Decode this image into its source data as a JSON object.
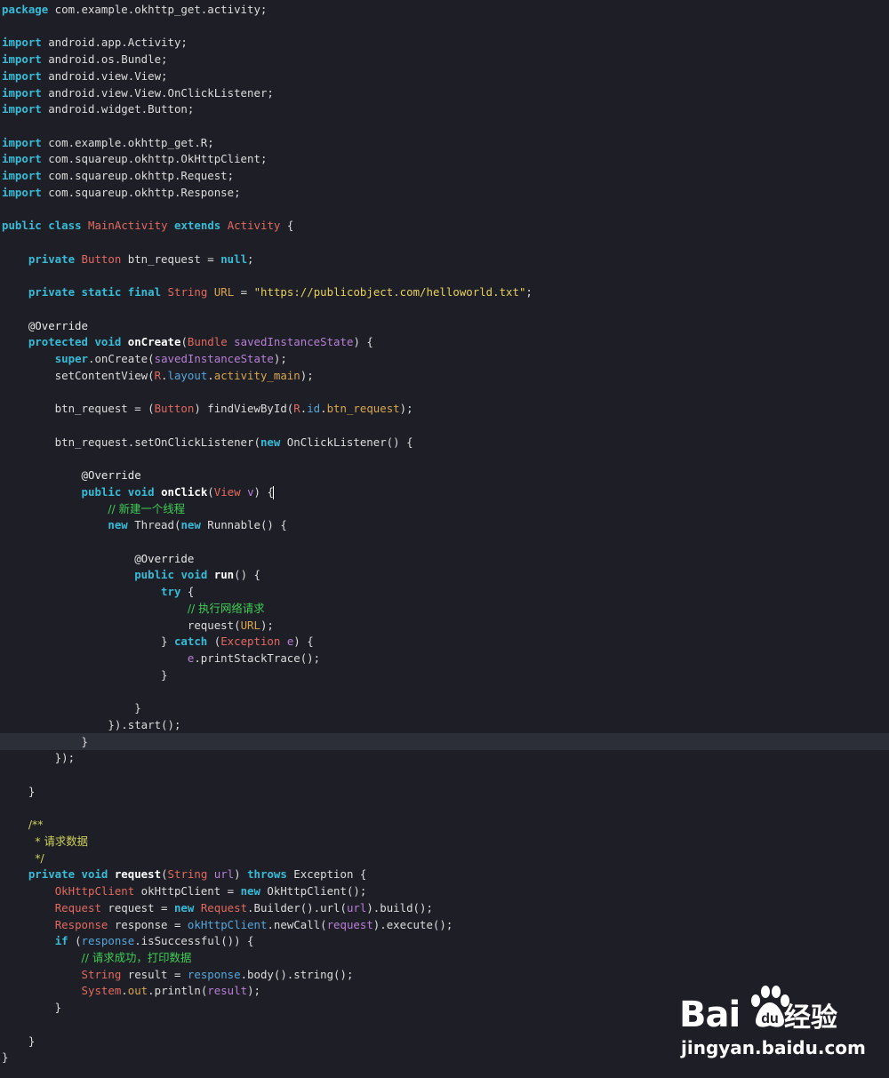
{
  "editor": {
    "language": "java",
    "cursor_line": 44,
    "colors": {
      "background": "#1e1f26",
      "current_line": "#2c2e38",
      "keyword": "#37bbd6",
      "type": "#e2695f",
      "string": "#e6cf5c",
      "comment": "#3fcd55",
      "field": "#55a6dc",
      "parameter": "#b87fd6"
    },
    "lines": [
      [
        [
          "kw",
          "package"
        ],
        [
          "tx",
          " com.example.okhttp_get.activity;"
        ]
      ],
      [],
      [
        [
          "kw",
          "import"
        ],
        [
          "tx",
          " android.app.Activity;"
        ]
      ],
      [
        [
          "kw",
          "import"
        ],
        [
          "tx",
          " android.os.Bundle;"
        ]
      ],
      [
        [
          "kw",
          "import"
        ],
        [
          "tx",
          " android.view.View;"
        ]
      ],
      [
        [
          "kw",
          "import"
        ],
        [
          "tx",
          " android.view.View.OnClickListener;"
        ]
      ],
      [
        [
          "kw",
          "import"
        ],
        [
          "tx",
          " android.widget.Button;"
        ]
      ],
      [],
      [
        [
          "kw",
          "import"
        ],
        [
          "tx",
          " com.example.okhttp_get.R;"
        ]
      ],
      [
        [
          "kw",
          "import"
        ],
        [
          "tx",
          " com.squareup.okhttp.OkHttpClient;"
        ]
      ],
      [
        [
          "kw",
          "import"
        ],
        [
          "tx",
          " com.squareup.okhttp.Request;"
        ]
      ],
      [
        [
          "kw",
          "import"
        ],
        [
          "tx",
          " com.squareup.okhttp.Response;"
        ]
      ],
      [],
      [
        [
          "kw",
          "public"
        ],
        [
          "tx",
          " "
        ],
        [
          "kw",
          "class"
        ],
        [
          "tx",
          " "
        ],
        [
          "ty",
          "MainActivity"
        ],
        [
          "tx",
          " "
        ],
        [
          "kw",
          "extends"
        ],
        [
          "tx",
          " "
        ],
        [
          "ty",
          "Activity"
        ],
        [
          "tx",
          " {"
        ]
      ],
      [],
      [
        [
          "tx",
          "    "
        ],
        [
          "kw",
          "private"
        ],
        [
          "tx",
          " "
        ],
        [
          "ty",
          "Button"
        ],
        [
          "tx",
          " btn_request = "
        ],
        [
          "kw",
          "null"
        ],
        [
          "tx",
          ";"
        ]
      ],
      [],
      [
        [
          "tx",
          "    "
        ],
        [
          "kw",
          "private"
        ],
        [
          "tx",
          " "
        ],
        [
          "kw",
          "static"
        ],
        [
          "tx",
          " "
        ],
        [
          "kw",
          "final"
        ],
        [
          "tx",
          " "
        ],
        [
          "ty",
          "String"
        ],
        [
          "tx",
          " "
        ],
        [
          "fi",
          "URL"
        ],
        [
          "tx",
          " = "
        ],
        [
          "st",
          "\"https://publicobject.com/helloworld.txt\""
        ],
        [
          "tx",
          ";"
        ]
      ],
      [],
      [
        [
          "tx",
          "    "
        ],
        [
          "an",
          "@Override"
        ]
      ],
      [
        [
          "tx",
          "    "
        ],
        [
          "kw",
          "protected"
        ],
        [
          "tx",
          " "
        ],
        [
          "kw",
          "void"
        ],
        [
          "tx",
          " "
        ],
        [
          "mt",
          "onCreate"
        ],
        [
          "tx",
          "("
        ],
        [
          "ty",
          "Bundle"
        ],
        [
          "tx",
          " "
        ],
        [
          "pa",
          "savedInstanceState"
        ],
        [
          "tx",
          ") {"
        ]
      ],
      [
        [
          "tx",
          "        "
        ],
        [
          "kw",
          "super"
        ],
        [
          "tx",
          ".onCreate("
        ],
        [
          "pa",
          "savedInstanceState"
        ],
        [
          "tx",
          ");"
        ]
      ],
      [
        [
          "tx",
          "        setContentView("
        ],
        [
          "ty",
          "R"
        ],
        [
          "tx",
          "."
        ],
        [
          "fd",
          "layout"
        ],
        [
          "tx",
          "."
        ],
        [
          "fi",
          "activity_main"
        ],
        [
          "tx",
          ");"
        ]
      ],
      [],
      [
        [
          "tx",
          "        btn_request = ("
        ],
        [
          "ty",
          "Button"
        ],
        [
          "tx",
          ") findViewById("
        ],
        [
          "ty",
          "R"
        ],
        [
          "tx",
          "."
        ],
        [
          "fd",
          "id"
        ],
        [
          "tx",
          "."
        ],
        [
          "fi",
          "btn_request"
        ],
        [
          "tx",
          ");"
        ]
      ],
      [],
      [
        [
          "tx",
          "        btn_request.setOnClickListener("
        ],
        [
          "kw",
          "new"
        ],
        [
          "tx",
          " OnClickListener() {"
        ]
      ],
      [],
      [
        [
          "tx",
          "            "
        ],
        [
          "an",
          "@Override"
        ]
      ],
      [
        [
          "tx",
          "            "
        ],
        [
          "kw",
          "public"
        ],
        [
          "tx",
          " "
        ],
        [
          "kw",
          "void"
        ],
        [
          "tx",
          " "
        ],
        [
          "mt",
          "onClick"
        ],
        [
          "tx",
          "("
        ],
        [
          "ty",
          "View"
        ],
        [
          "tx",
          " "
        ],
        [
          "pa",
          "v"
        ],
        [
          "tx",
          ") {"
        ]
      ],
      [
        [
          "tx",
          "                "
        ],
        [
          "cm",
          "// 新建一个线程"
        ]
      ],
      [
        [
          "tx",
          "                "
        ],
        [
          "kw",
          "new"
        ],
        [
          "tx",
          " Thread("
        ],
        [
          "kw",
          "new"
        ],
        [
          "tx",
          " Runnable() {"
        ]
      ],
      [],
      [
        [
          "tx",
          "                    "
        ],
        [
          "an",
          "@Override"
        ]
      ],
      [
        [
          "tx",
          "                    "
        ],
        [
          "kw",
          "public"
        ],
        [
          "tx",
          " "
        ],
        [
          "kw",
          "void"
        ],
        [
          "tx",
          " "
        ],
        [
          "mt",
          "run"
        ],
        [
          "tx",
          "() {"
        ]
      ],
      [
        [
          "tx",
          "                        "
        ],
        [
          "kw",
          "try"
        ],
        [
          "tx",
          " {"
        ]
      ],
      [
        [
          "tx",
          "                            "
        ],
        [
          "cm",
          "// 执行网络请求"
        ]
      ],
      [
        [
          "tx",
          "                            request("
        ],
        [
          "fi",
          "URL"
        ],
        [
          "tx",
          ");"
        ]
      ],
      [
        [
          "tx",
          "                        } "
        ],
        [
          "kw",
          "catch"
        ],
        [
          "tx",
          " ("
        ],
        [
          "ty",
          "Exception"
        ],
        [
          "tx",
          " "
        ],
        [
          "pa",
          "e"
        ],
        [
          "tx",
          ") {"
        ]
      ],
      [
        [
          "tx",
          "                            "
        ],
        [
          "pa",
          "e"
        ],
        [
          "tx",
          ".printStackTrace();"
        ]
      ],
      [
        [
          "tx",
          "                        }"
        ]
      ],
      [],
      [
        [
          "tx",
          "                    }"
        ]
      ],
      [
        [
          "tx",
          "                }).start();"
        ]
      ],
      [
        [
          "tx",
          "            }"
        ]
      ],
      [
        [
          "tx",
          "        });"
        ]
      ],
      [],
      [
        [
          "tx",
          "    }"
        ]
      ],
      [],
      [
        [
          "tx",
          "    "
        ],
        [
          "jd",
          "/**"
        ]
      ],
      [
        [
          "tx",
          "     "
        ],
        [
          "jd",
          "* 请求数据"
        ]
      ],
      [
        [
          "tx",
          "     "
        ],
        [
          "jd",
          "*/"
        ]
      ],
      [
        [
          "tx",
          "    "
        ],
        [
          "kw",
          "private"
        ],
        [
          "tx",
          " "
        ],
        [
          "kw",
          "void"
        ],
        [
          "tx",
          " "
        ],
        [
          "mt",
          "request"
        ],
        [
          "tx",
          "("
        ],
        [
          "ty",
          "String"
        ],
        [
          "tx",
          " "
        ],
        [
          "pa",
          "url"
        ],
        [
          "tx",
          ") "
        ],
        [
          "kw",
          "throws"
        ],
        [
          "tx",
          " Exception {"
        ]
      ],
      [
        [
          "tx",
          "        "
        ],
        [
          "ty",
          "OkHttpClient"
        ],
        [
          "tx",
          " okHttpClient = "
        ],
        [
          "kw",
          "new"
        ],
        [
          "tx",
          " OkHttpClient();"
        ]
      ],
      [
        [
          "tx",
          "        "
        ],
        [
          "ty",
          "Request"
        ],
        [
          "tx",
          " request = "
        ],
        [
          "kw",
          "new"
        ],
        [
          "tx",
          " "
        ],
        [
          "ty",
          "Request"
        ],
        [
          "tx",
          ".Builder().url("
        ],
        [
          "pa",
          "url"
        ],
        [
          "tx",
          ").build();"
        ]
      ],
      [
        [
          "tx",
          "        "
        ],
        [
          "ty",
          "Response"
        ],
        [
          "tx",
          " response = "
        ],
        [
          "fd",
          "okHttpClient"
        ],
        [
          "tx",
          ".newCall("
        ],
        [
          "pa",
          "request"
        ],
        [
          "tx",
          ").execute();"
        ]
      ],
      [
        [
          "tx",
          "        "
        ],
        [
          "kw",
          "if"
        ],
        [
          "tx",
          " ("
        ],
        [
          "fd",
          "response"
        ],
        [
          "tx",
          ".isSuccessful()) {"
        ]
      ],
      [
        [
          "tx",
          "            "
        ],
        [
          "cm",
          "// 请求成功，打印数据"
        ]
      ],
      [
        [
          "tx",
          "            "
        ],
        [
          "ty",
          "String"
        ],
        [
          "tx",
          " result = "
        ],
        [
          "fd",
          "response"
        ],
        [
          "tx",
          ".body().string();"
        ]
      ],
      [
        [
          "tx",
          "            "
        ],
        [
          "ty",
          "System"
        ],
        [
          "tx",
          "."
        ],
        [
          "fi",
          "out"
        ],
        [
          "tx",
          ".println("
        ],
        [
          "pa",
          "result"
        ],
        [
          "tx",
          ");"
        ]
      ],
      [
        [
          "tx",
          "        }"
        ]
      ],
      [],
      [
        [
          "tx",
          "    }"
        ]
      ],
      [
        [
          "tx",
          "}"
        ]
      ]
    ]
  },
  "watermark": {
    "brand": "Bai",
    "brand_cn": "经验",
    "url": "jingyan.baidu.com",
    "icon": "baidu-paw-icon"
  }
}
